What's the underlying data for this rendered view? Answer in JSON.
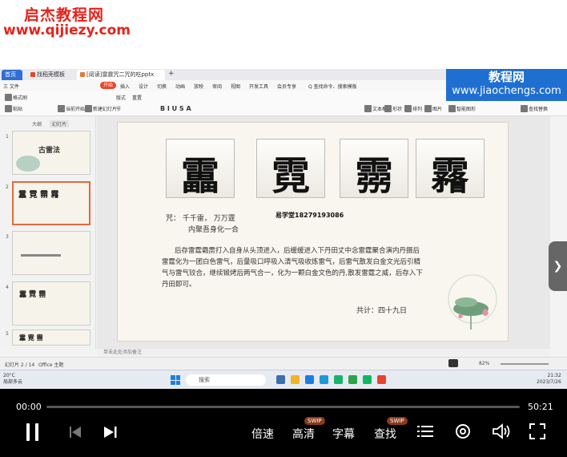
{
  "watermark": {
    "title": "启杰教程网",
    "url": "www.qijiezy.com",
    "jc_title": "教程网",
    "jc_url": "www.jiaochengs.com"
  },
  "tabs": [
    {
      "label": "首页"
    },
    {
      "label": "找稻壳模板"
    },
    {
      "label": "[阅读]雷霆咒二咒的吃pptx"
    }
  ],
  "menu": [
    "三 文件",
    "开始",
    "插入",
    "设计",
    "切换",
    "动画",
    "放映",
    "审阅",
    "视图",
    "开发工具",
    "会员专享",
    "Q 查找命令、搜索模板"
  ],
  "ribbon": [
    "格式刷",
    "粘贴",
    "当前开始",
    "新建幻灯片",
    "版式",
    "节",
    "重置",
    "文本框",
    "形状",
    "排列",
    "图片",
    "智能图形",
    "查找替换"
  ],
  "thumb_tabs": [
    "大纲",
    "幻灯片"
  ],
  "thumbs": [
    {
      "num": "1",
      "text": "古雷法"
    },
    {
      "num": "2",
      "text": ""
    },
    {
      "num": "3",
      "text": ""
    },
    {
      "num": "4",
      "text": ""
    },
    {
      "num": "5",
      "text": ""
    }
  ],
  "slide": {
    "chars": [
      "靁",
      "霓",
      "霛",
      "霿"
    ],
    "line1": "咒：  千千雷，  万万霆",
    "line2": "内聚吾身化一合",
    "contact": "易学堂18279193086",
    "paragraph": "后存雷霆霸雳打入自身从头顶进入，后缓缓进入下丹田丈中念雷霆聚合演内丹摄后雷霆化为一团白色雷气，后量吸口呼吸入清气吸收炼雷气，后雷气散发白金文光后引精气与雷气铰合，继续锻烤后两气合一，化为一颗白金文色的丹,散发雷霆之威，后存入下丹田即可。",
    "total": "共计：四十九日"
  },
  "notes": "单击此处添加备注",
  "status": {
    "left": "幻灯片 2 / 14",
    "theme": "Office 主题",
    "zoom": "82%"
  },
  "taskbar": {
    "weather_temp": "20°C",
    "weather_desc": "局部多云",
    "search": "搜索",
    "time": "21:32",
    "date": "2023/7/26"
  },
  "player": {
    "current": "00:00",
    "total": "50:21",
    "progress": 0.0,
    "labels": {
      "speed": "倍速",
      "quality": "高清",
      "subtitle": "字幕",
      "search": "查找"
    },
    "badges": {
      "quality": "SWIP",
      "search": "SWIP"
    }
  }
}
